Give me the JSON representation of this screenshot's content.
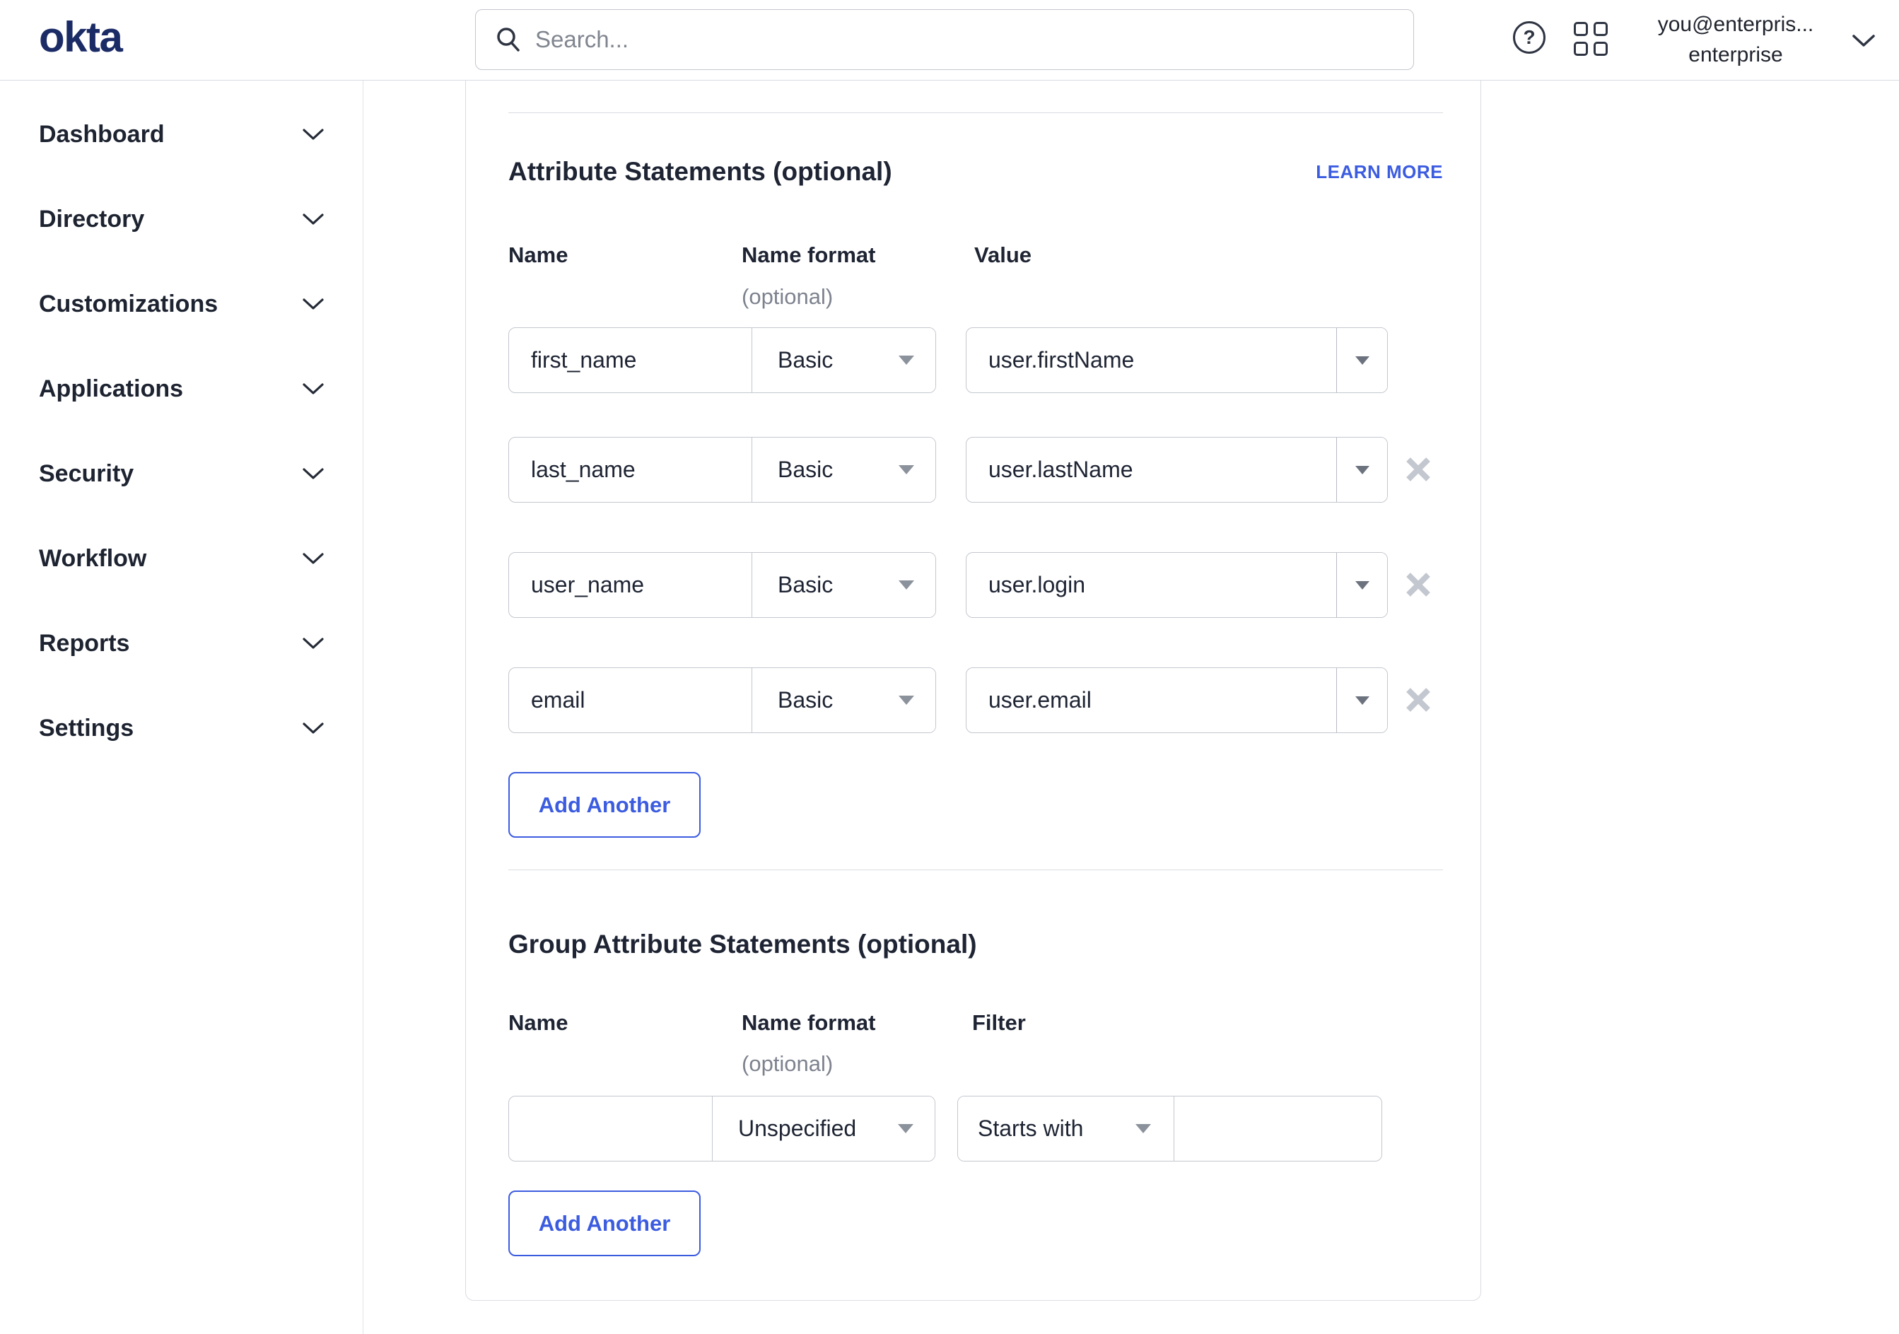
{
  "brand": {
    "logo_text": "okta",
    "logo_color": "#1b2b66"
  },
  "topbar": {
    "search_placeholder": "Search...",
    "icons": [
      "search-icon",
      "help-icon",
      "apps-grid-icon",
      "chevron-down-icon"
    ],
    "account": {
      "line1": "you@enterpris...",
      "line2": "enterprise"
    }
  },
  "sidebar": {
    "items": [
      "Dashboard",
      "Directory",
      "Customizations",
      "Applications",
      "Security",
      "Workflow",
      "Reports",
      "Settings"
    ]
  },
  "main": {
    "attribute_section": {
      "title": "Attribute Statements (optional)",
      "learn_more": "LEARN MORE",
      "columns": {
        "name": "Name",
        "name_format": "Name format",
        "name_format_note": "(optional)",
        "value": "Value"
      },
      "rows": [
        {
          "name": "first_name",
          "format": "Basic",
          "value": "user.firstName"
        },
        {
          "name": "last_name",
          "format": "Basic",
          "value": "user.lastName"
        },
        {
          "name": "user_name",
          "format": "Basic",
          "value": "user.login"
        },
        {
          "name": "email",
          "format": "Basic",
          "value": "user.email"
        }
      ],
      "add_button": "Add Another"
    },
    "group_section": {
      "title": "Group Attribute Statements (optional)",
      "columns": {
        "name": "Name",
        "name_format": "Name format",
        "name_format_note": "(optional)",
        "filter": "Filter"
      },
      "rows": [
        {
          "name": "",
          "format": "Unspecified",
          "filter_type": "Starts with",
          "filter_value": ""
        }
      ],
      "add_button": "Add Another"
    }
  },
  "colors": {
    "accent_blue": "#3c5ce0",
    "logo_navy": "#1b2b66",
    "delete_x": "#c3c7cf"
  }
}
